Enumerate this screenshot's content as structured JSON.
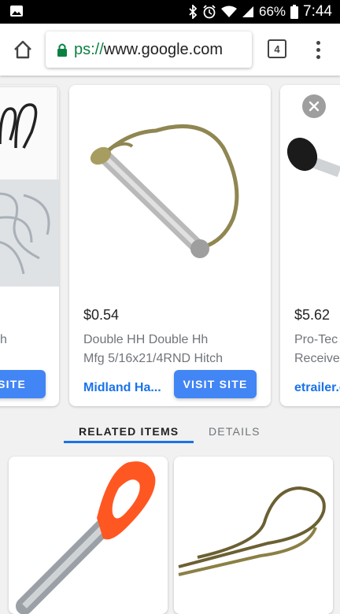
{
  "status_bar": {
    "battery": "66%",
    "time": "7:44"
  },
  "browser": {
    "url_scheme": "ps://",
    "url_host": "www.google.com",
    "tab_count": "4"
  },
  "products": [
    {
      "price": "",
      "desc_line1": "",
      "desc_line2": "h",
      "merchant": "",
      "visit_label": "VISIT SITE"
    },
    {
      "price": "$0.54",
      "desc_line1": "Double HH Double Hh",
      "desc_line2": "Mfg 5/16x21/4RND Hitch",
      "merchant": "Midland Ha...",
      "visit_label": "VISIT SITE"
    },
    {
      "price": "$5.62",
      "desc_line1": "Pro-Tec",
      "desc_line2": "Receive",
      "merchant": "etrailer.c"
    }
  ],
  "tabs": {
    "related": "RELATED ITEMS",
    "details": "DETAILS"
  },
  "colors": {
    "accent": "#1a73e8",
    "button": "#4285f4",
    "secure": "#0b8043"
  },
  "icons": [
    "image-icon",
    "bluetooth-icon",
    "alarm-icon",
    "wifi-icon",
    "signal-icon",
    "battery-icon",
    "home-icon",
    "lock-icon",
    "tabs-icon",
    "overflow-menu-icon",
    "close-icon"
  ]
}
